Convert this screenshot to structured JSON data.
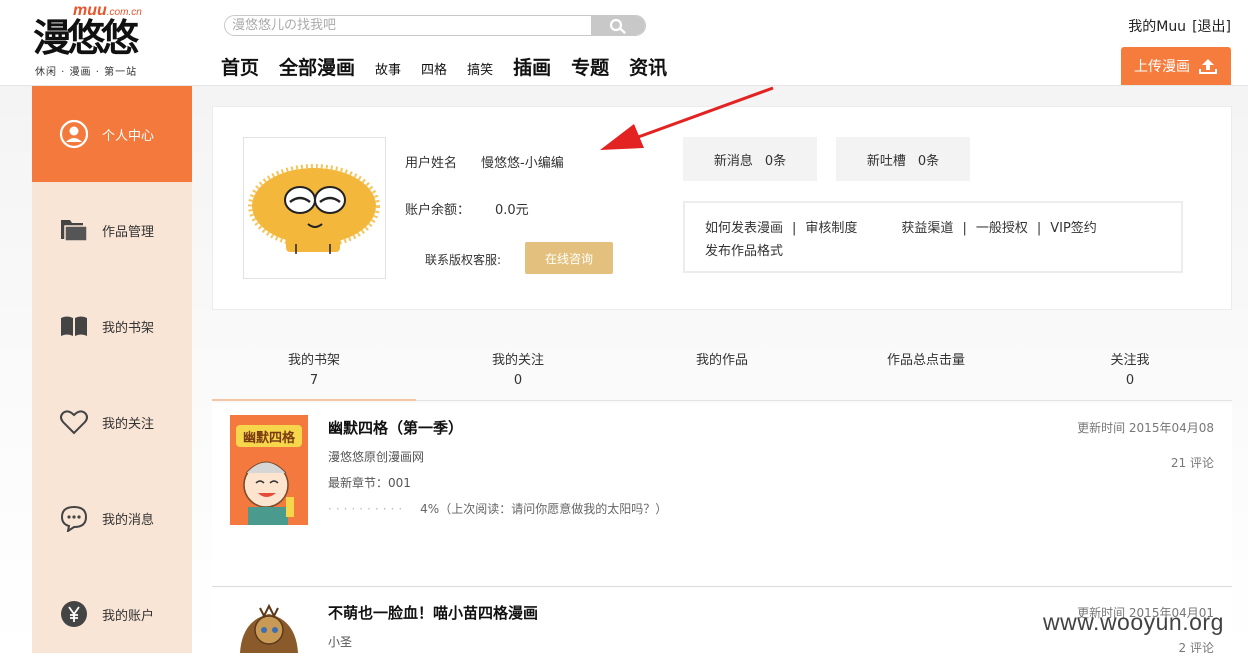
{
  "header": {
    "logo": {
      "muu": "muu",
      "domain": ".com.cn",
      "name": "漫悠悠",
      "tagline": "休闲 · 漫画 · 第一站"
    },
    "search": {
      "placeholder": "漫悠悠儿の找我吧",
      "button_icon": "search-icon"
    },
    "nav": [
      {
        "label": "首页",
        "size": "big"
      },
      {
        "label": "全部漫画",
        "size": "big"
      },
      {
        "label": "故事",
        "size": "small"
      },
      {
        "label": "四格",
        "size": "small"
      },
      {
        "label": "搞笑",
        "size": "small"
      },
      {
        "label": "插画",
        "size": "big"
      },
      {
        "label": "专题",
        "size": "big"
      },
      {
        "label": "资讯",
        "size": "big"
      }
    ],
    "user": {
      "my_link": "我的Muu",
      "logout": "[退出]"
    },
    "upload": {
      "label": "上传漫画",
      "icon": "upload-icon"
    }
  },
  "sidebar": {
    "items": [
      {
        "label": "个人中心",
        "icon": "user-circle-icon",
        "active": true
      },
      {
        "label": "作品管理",
        "icon": "folder-icon",
        "active": false
      },
      {
        "label": "我的书架",
        "icon": "book-icon",
        "active": false
      },
      {
        "label": "我的关注",
        "icon": "heart-icon",
        "active": false
      },
      {
        "label": "我的消息",
        "icon": "chat-bubble-icon",
        "active": false
      },
      {
        "label": "我的账户",
        "icon": "yen-coin-icon",
        "active": false
      }
    ]
  },
  "profile": {
    "username_label": "用户姓名",
    "username": "慢悠悠-小编编",
    "balance_label": "账户余额：",
    "balance": "0.0元",
    "copyright_label": "联系版权客服:",
    "consult_button": "在线咨询",
    "new_messages": {
      "label": "新消息",
      "count": "0条"
    },
    "new_comments": {
      "label": "新吐槽",
      "count": "0条"
    },
    "help_links": [
      "如何发表漫画",
      "审核制度",
      "获益渠道",
      "一般授权",
      "VIP签约"
    ],
    "help_links_row2": [
      "发布作品格式"
    ],
    "separator": "|"
  },
  "tabs": [
    {
      "label": "我的书架",
      "value": "7",
      "active": true
    },
    {
      "label": "我的关注",
      "value": "0",
      "active": false
    },
    {
      "label": "我的作品",
      "value": "",
      "active": false
    },
    {
      "label": "作品总点击量",
      "value": "",
      "active": false
    },
    {
      "label": "关注我",
      "value": "0",
      "active": false
    }
  ],
  "shelf": [
    {
      "title": "幽默四格（第一季）",
      "author": "漫悠悠原创漫画网",
      "latest": "最新章节：001",
      "dots": "··········",
      "progress": "4%（上次阅读：请问你愿意做我的太阳吗？）",
      "updated": "更新时间 2015年04月08",
      "comments": "21 评论",
      "cover_text": "幽默四格"
    },
    {
      "title": "不萌也一脸血！喵小苗四格漫画",
      "author": "小圣",
      "updated": "更新时间 2015年04月01",
      "comments": "2 评论"
    }
  ],
  "watermark": "www.wooyun.org",
  "colors": {
    "accent": "#f57c3d",
    "sidebar_bg": "#f8e5d6",
    "consult": "#e3c07d",
    "arrow": "#e32222"
  }
}
